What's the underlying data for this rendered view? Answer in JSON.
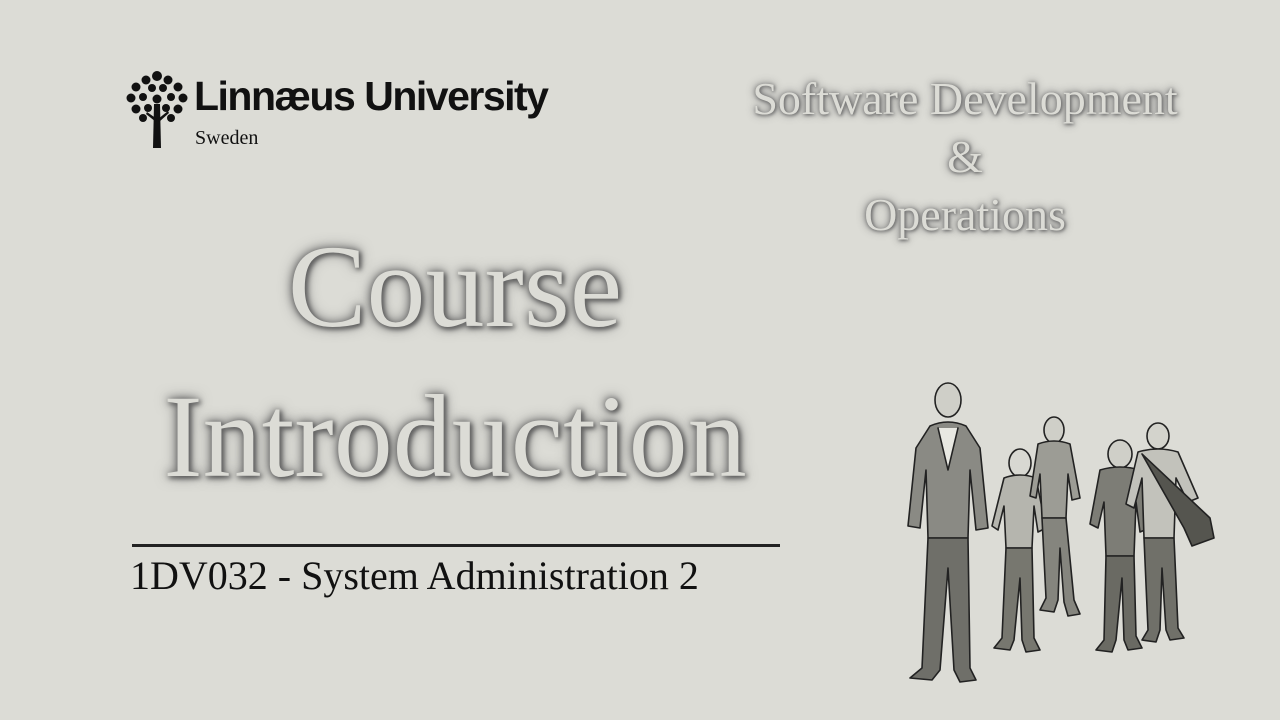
{
  "logo": {
    "name": "Linnæus University",
    "subtitle": "Sweden"
  },
  "program": {
    "line1": "Software Development",
    "line2": "&",
    "line3": "Operations"
  },
  "title": {
    "line1": "Course",
    "line2": "Introduction"
  },
  "course": {
    "code_title": "1DV032 - System Administration 2"
  },
  "colors": {
    "background": "#dcdcd6",
    "text_dark": "#111111",
    "embossed_text": "#dcdcd6"
  },
  "illustration": {
    "icon": "students-walking-sketch"
  }
}
